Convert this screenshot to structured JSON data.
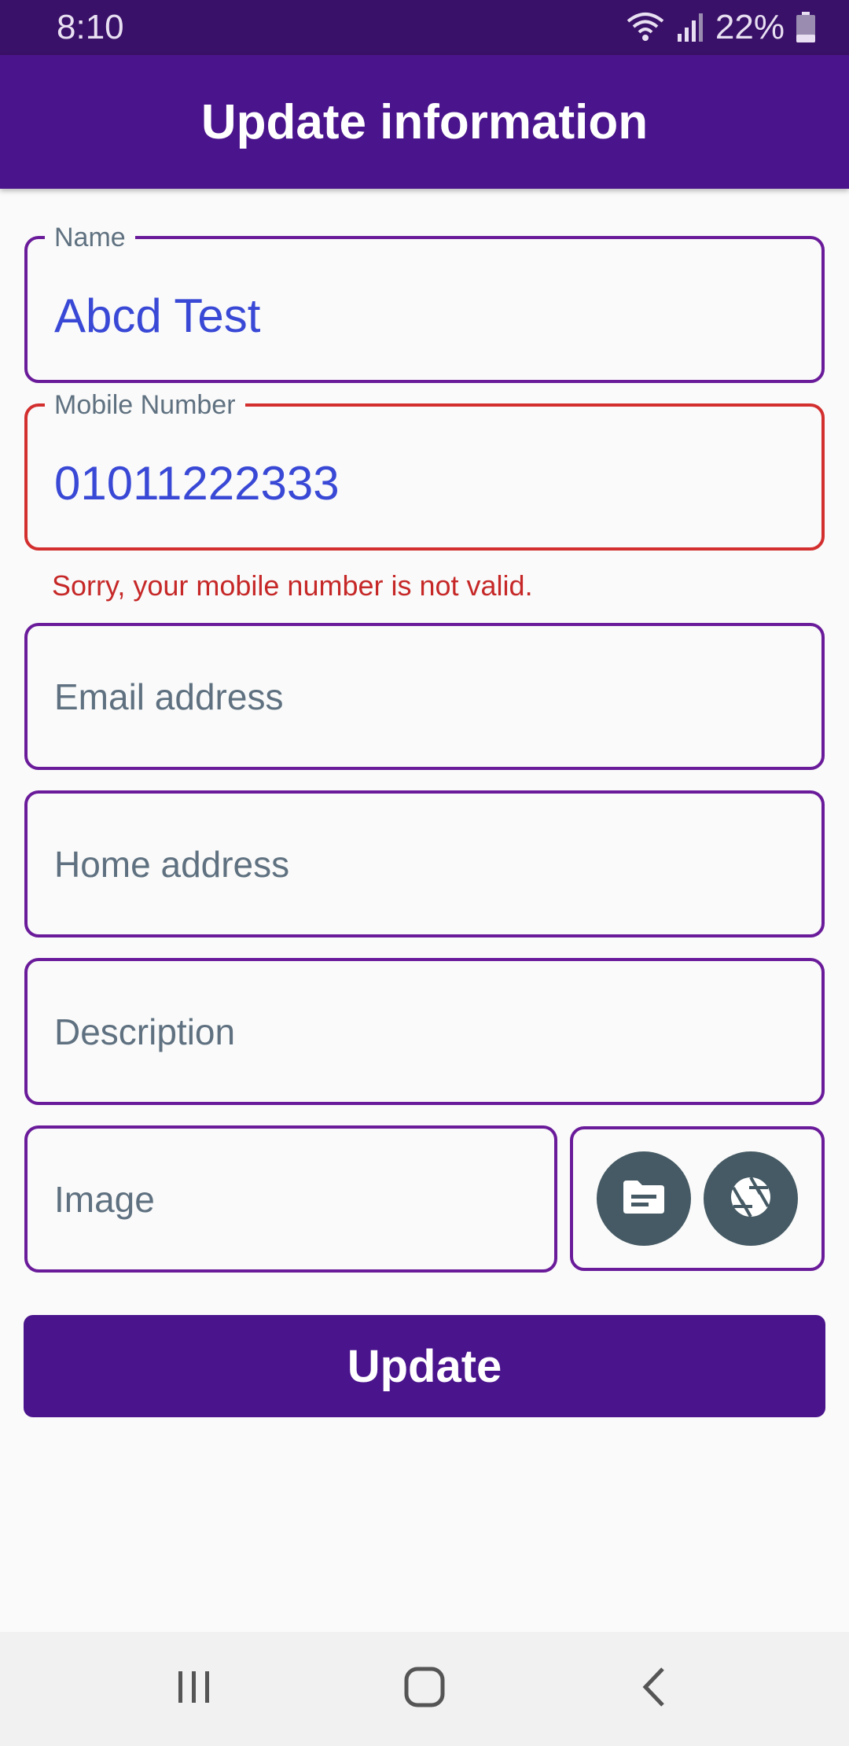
{
  "status_bar": {
    "time": "8:10",
    "battery": "22%"
  },
  "app_bar": {
    "title": "Update information"
  },
  "form": {
    "name": {
      "label": "Name",
      "value": "Abcd Test"
    },
    "mobile": {
      "label": "Mobile Number",
      "value": "01011222333",
      "error": "Sorry, your mobile number is not valid."
    },
    "email": {
      "placeholder": "Email address"
    },
    "home": {
      "placeholder": "Home address"
    },
    "description": {
      "placeholder": "Description"
    },
    "image": {
      "placeholder": "Image"
    },
    "update_label": "Update"
  },
  "icons": {
    "file": "file-icon",
    "camera": "camera-shutter-icon"
  },
  "colors": {
    "primary": "#4a148c",
    "status_bar": "#3a1168",
    "field_border": "#6a1b9a",
    "error": "#d32f2f",
    "value_text": "#3949d6",
    "icon_button": "#455a64"
  }
}
